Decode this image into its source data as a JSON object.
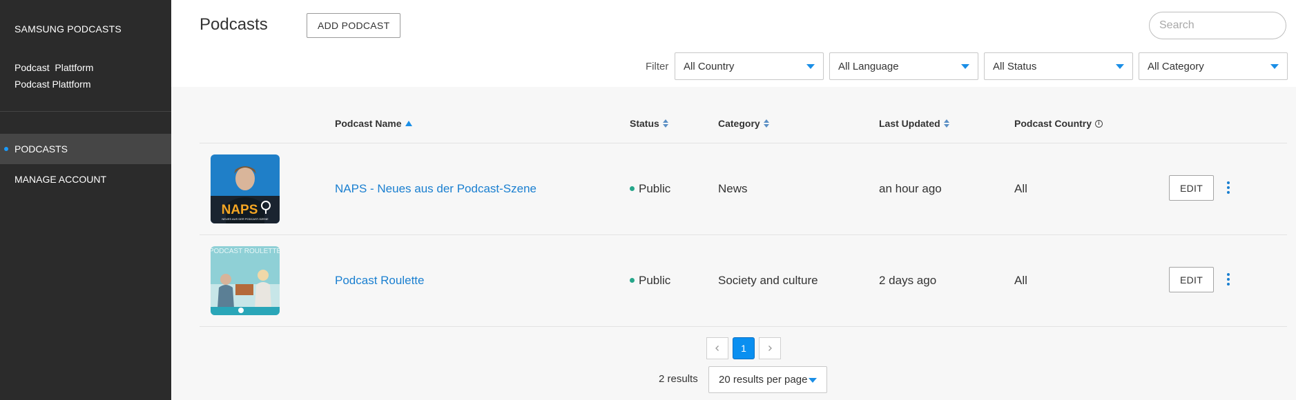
{
  "sidebar": {
    "brand": "SAMSUNG PODCASTS",
    "org_line1": "Podcast  Plattform",
    "org_line2": "Podcast Plattform",
    "items": [
      {
        "label": "PODCASTS",
        "active": true
      },
      {
        "label": "MANAGE ACCOUNT",
        "active": false
      }
    ]
  },
  "header": {
    "title": "Podcasts",
    "add_button": "ADD PODCAST",
    "search_placeholder": "Search"
  },
  "filters": {
    "label": "Filter",
    "country": "All Country",
    "language": "All Language",
    "status": "All Status",
    "category": "All Category"
  },
  "table": {
    "columns": {
      "name": "Podcast Name",
      "status": "Status",
      "category": "Category",
      "updated": "Last Updated",
      "country": "Podcast Country"
    },
    "rows": [
      {
        "name": "NAPS - Neues aus der Podcast-Szene",
        "status": "Public",
        "category": "News",
        "updated": "an hour ago",
        "country": "All",
        "edit": "EDIT",
        "cover_text": "NAPS",
        "cover_sub": "NEUES AUS DER PODCAST-SZENE"
      },
      {
        "name": "Podcast Roulette",
        "status": "Public",
        "category": "Society and culture",
        "updated": "2 days ago",
        "country": "All",
        "edit": "EDIT",
        "cover_text": "PODCAST ROULETTE"
      }
    ]
  },
  "pagination": {
    "current_page": "1",
    "results": "2 results",
    "per_page": "20 results per page"
  },
  "colors": {
    "sidebar_bg": "#2b2b2b",
    "accent": "#1a8ee6",
    "link": "#1a7fd0",
    "status_public": "#26a68a"
  }
}
